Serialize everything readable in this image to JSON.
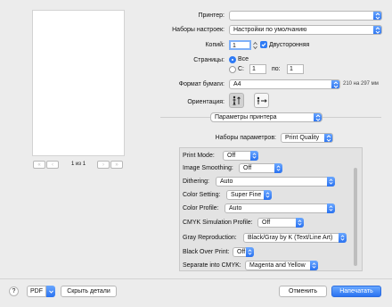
{
  "preview": {
    "page_indicator": "1 из 1",
    "nav_first": "«",
    "nav_prev": "‹",
    "nav_next": "›",
    "nav_last": "»"
  },
  "settings": {
    "printer_label": "Принтер:",
    "printer_value": "",
    "presets_label": "Наборы настроек:",
    "presets_value": "Настройки по умолчанию",
    "copies_label": "Копий:",
    "copies_value": "1",
    "duplex_label": "Двусторонняя",
    "pages_label": "Страницы:",
    "pages_all": "Все",
    "pages_from_label": "С:",
    "pages_from_value": "1",
    "pages_to_label": "по:",
    "pages_to_value": "1",
    "paper_label": "Формат бумаги:",
    "paper_value": "A4",
    "paper_dims": "210 на 297 мм",
    "orientation_label": "Ориентация:",
    "section_value": "Параметры принтера"
  },
  "printer_features": {
    "feature_sets_label": "Наборы параметров:",
    "feature_sets_value": "Print Quality",
    "items": [
      {
        "label": "Print Mode:",
        "value": "Off"
      },
      {
        "label": "Image Smoothing:",
        "value": "Off"
      },
      {
        "label": "Dithering:",
        "value": "Auto"
      },
      {
        "label": "Color Setting:",
        "value": "Super Fine"
      },
      {
        "label": "Color Profile:",
        "value": "Auto"
      },
      {
        "label": "CMYK Simulation Profile:",
        "value": "Off"
      },
      {
        "label": "Gray Reproduction:",
        "value": "Black/Gray by K (Text/Line Art)"
      },
      {
        "label": "Black Over Print:",
        "value": "Off"
      },
      {
        "label": "Separate into CMYK:",
        "value": "Magenta and Yellow"
      }
    ]
  },
  "footer": {
    "help": "?",
    "pdf": "PDF",
    "hide_details": "Скрыть детали",
    "cancel": "Отменить",
    "print": "Напечатать"
  },
  "colors": {
    "accent": "#2f7bf5",
    "background": "#ececec"
  }
}
